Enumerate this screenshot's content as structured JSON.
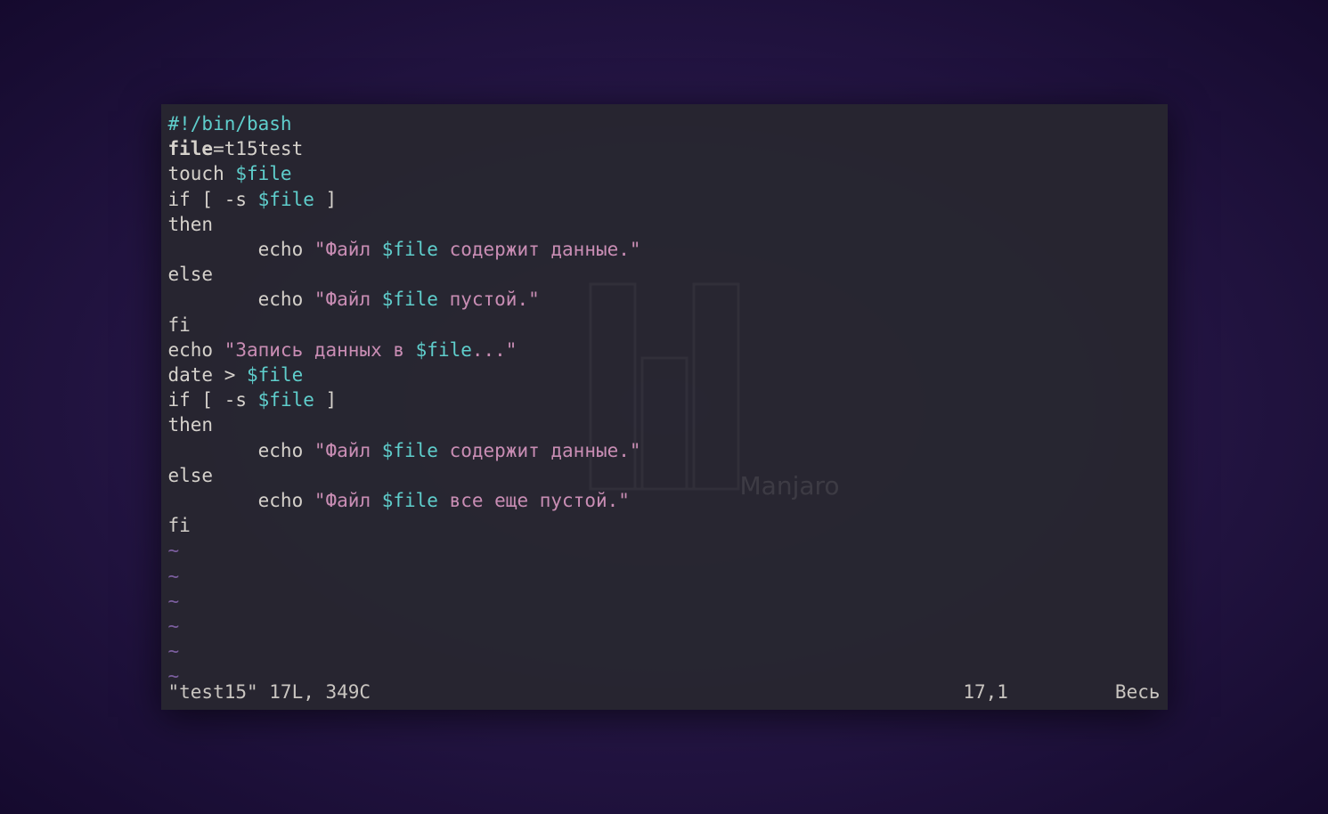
{
  "watermark": {
    "label": "Manjaro"
  },
  "code": {
    "line1_shebang": "#!/bin/bash",
    "line2_keyword": "file",
    "line2_rest": "=t15test",
    "line3_pre": "touch ",
    "line3_var": "$file",
    "line4_pre": "if [ -s ",
    "line4_var": "$file",
    "line4_post": " ]",
    "line5": "then",
    "line6_pre": "        echo ",
    "line6_str1": "\"Файл ",
    "line6_var": "$file",
    "line6_str2": " содержит данные.\"",
    "line7": "else",
    "line8_pre": "        echo ",
    "line8_str1": "\"Файл ",
    "line8_var": "$file",
    "line8_str2": " пустой.\"",
    "line9": "fi",
    "line10_pre": "echo ",
    "line10_str1": "\"Запись данных в ",
    "line10_var": "$file",
    "line10_str2": "...\"",
    "line11_pre": "date > ",
    "line11_var": "$file",
    "line12_pre": "if [ -s ",
    "line12_var": "$file",
    "line12_post": " ]",
    "line13": "then",
    "line14_pre": "        echo ",
    "line14_str1": "\"Файл ",
    "line14_var": "$file",
    "line14_str2": " содержит данные.\"",
    "line15": "else",
    "line16_pre": "        echo ",
    "line16_str1": "\"Файл ",
    "line16_var": "$file",
    "line16_str2": " все еще пустой.\"",
    "line17": "fi",
    "tilde": "~"
  },
  "status": {
    "file_info": "\"test15\" 17L, 349C",
    "position": "17,1",
    "scroll": "Весь"
  }
}
